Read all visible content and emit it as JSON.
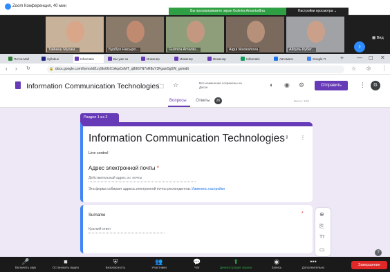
{
  "zoom": {
    "window_title": "Zoom Конференция, 40 мин",
    "viewing_banner": "Вы просматриваете экран Gulmira Amantur8na",
    "view_settings": "Настройки просмотра ⌄",
    "view_label": "▦ Вид"
  },
  "participants": [
    {
      "name": "Тайнеш Мухам...",
      "color": "#c9b29a",
      "face": "#d9a68a"
    },
    {
      "name": "Бурбул Насыро...",
      "color": "#8a7a6a",
      "face": "#c08a70"
    },
    {
      "name": "Gulmira Amantu...",
      "color": "#8f9e7a",
      "face": "#c49880"
    },
    {
      "name": "Aigul Medeshova",
      "color": "#7a6a5e",
      "face": "#b7907a"
    },
    {
      "name": "Айгуль Кубег...",
      "color": "#a0a2a6",
      "face": "#caa08a"
    }
  ],
  "browser": {
    "tabs": [
      {
        "label": "Почта Mail",
        "color": "#2e7d32"
      },
      {
        "label": "Syllabus",
        "color": "#1a237e"
      },
      {
        "label": "Informatio",
        "color": "#673ab7"
      },
      {
        "label": "Бы уже за",
        "color": "#673ab7"
      },
      {
        "label": "Инженер",
        "color": "#673ab7"
      },
      {
        "label": "Инженер",
        "color": "#673ab7"
      },
      {
        "label": "Инженер",
        "color": "#673ab7"
      },
      {
        "label": "Informatic",
        "color": "#0f9d58"
      },
      {
        "label": "Автомати",
        "color": "#1a73e8"
      },
      {
        "label": "Google П",
        "color": "#4285f4"
      }
    ],
    "url": "docs.google.com/forms/d/1cy9to6GX1AqsCeMT_q8tIG7N7nR8uY3Fgaxr5g5W_go/edit"
  },
  "form": {
    "doc_title": "Information Communication Technologies",
    "autosave": "Все изменения сохранены на Диске",
    "send_label": "Отправить",
    "avatar_letter": "G",
    "tab_questions": "Вопросы",
    "tab_answers": "Ответы",
    "answers_count": "26",
    "total_points": "Всего: 100",
    "section_tag": "Раздел 1 из 2",
    "title": "Information Communication Technologies",
    "subtitle": "Line control",
    "email_label": "Адрес электронной почты",
    "email_placeholder": "Действительный адрес эл. почты",
    "email_note": "Эта форма собирает адреса электронной почты респондентов.",
    "email_note_link": "Изменить настройки",
    "question_surname": "Surname",
    "short_answer": "Краткий ответ"
  },
  "zoom_toolbar": [
    {
      "icon": "🎤",
      "label": "Включить звук"
    },
    {
      "icon": "■",
      "label": "Остановить видео"
    },
    {
      "icon": "⛨",
      "label": "Безопасность"
    },
    {
      "icon": "👥",
      "label": "Участники"
    },
    {
      "icon": "💬",
      "label": "Чат"
    },
    {
      "icon": "⬆",
      "label": "Демонстрация экрана"
    },
    {
      "icon": "◉",
      "label": "Запись"
    },
    {
      "icon": "•••",
      "label": "Дополнительно"
    }
  ],
  "end_label": "Завершение"
}
